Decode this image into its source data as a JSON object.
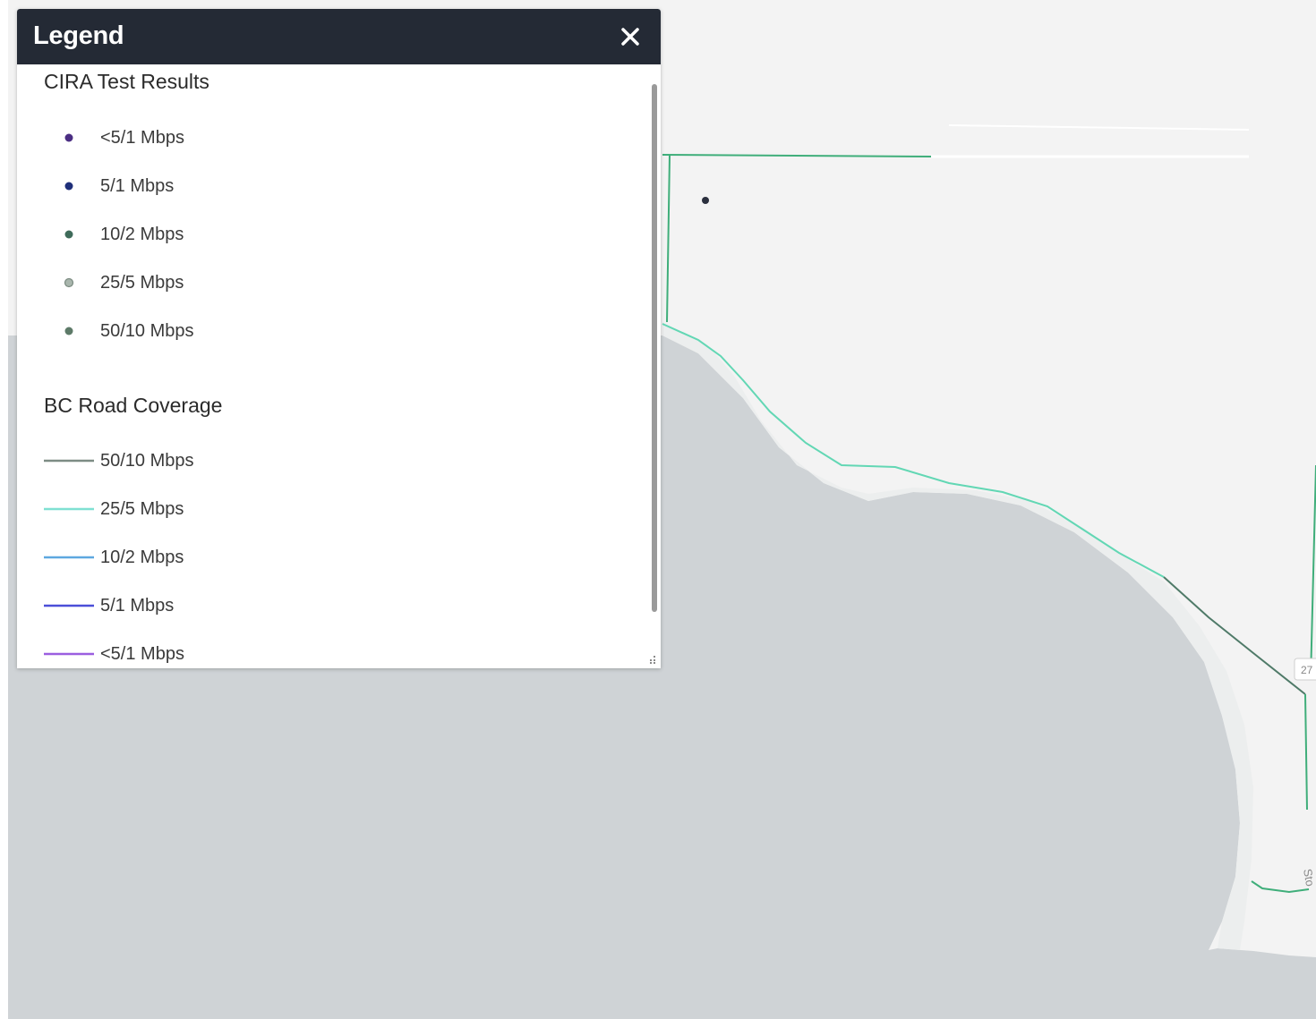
{
  "legend": {
    "title": "Legend",
    "close_icon": "close-icon",
    "sections": [
      {
        "heading": "CIRA Test Results",
        "items": [
          {
            "label": "<5/1 Mbps",
            "color": "#4b2e83",
            "symbol": "dot"
          },
          {
            "label": "5/1 Mbps",
            "color": "#1f2f7a",
            "symbol": "dot"
          },
          {
            "label": "10/2 Mbps",
            "color": "#3f6b5a",
            "symbol": "dot"
          },
          {
            "label": "25/5 Mbps",
            "color": "#a9b6ad",
            "symbol": "dot"
          },
          {
            "label": "50/10 Mbps",
            "color": "#5d7a68",
            "symbol": "dot"
          }
        ]
      },
      {
        "heading": "BC Road Coverage",
        "items": [
          {
            "label": "50/10 Mbps",
            "color": "#7d8c84",
            "symbol": "line"
          },
          {
            "label": "25/5 Mbps",
            "color": "#7fe0d2",
            "symbol": "line"
          },
          {
            "label": "10/2 Mbps",
            "color": "#5ea8e0",
            "symbol": "line"
          },
          {
            "label": "5/1 Mbps",
            "color": "#4b4fd8",
            "symbol": "line"
          },
          {
            "label": "<5/1 Mbps",
            "color": "#9b5ee0",
            "symbol": "line"
          }
        ]
      }
    ]
  },
  "map": {
    "land_color": "#f3f3f3",
    "water_color": "#cfd3d6",
    "road_coverage_color": "#62c9a4",
    "road_dark_color": "#4f7a68",
    "highway_shield_label": "27",
    "road_label": "Sto"
  }
}
